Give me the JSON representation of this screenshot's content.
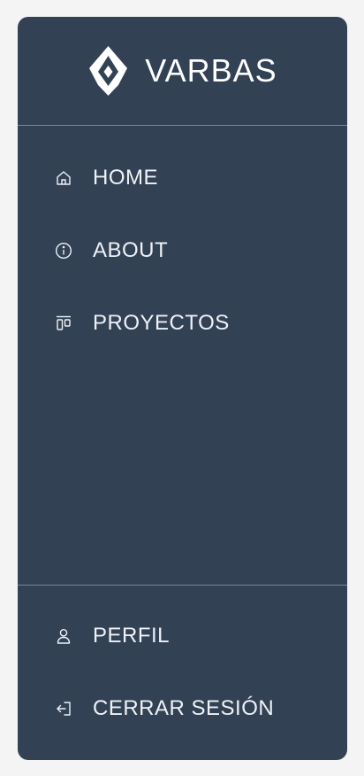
{
  "brand": {
    "name": "VARBAS",
    "logo_icon": "varbas-logo-icon"
  },
  "colors": {
    "page_background": "#f4f4f5",
    "sidebar_background": "#334155",
    "text": "#eef2f6",
    "divider": "#7a8798"
  },
  "nav": {
    "top_items": [
      {
        "label": "HOME",
        "icon": "home-icon"
      },
      {
        "label": "ABOUT",
        "icon": "info-icon"
      },
      {
        "label": "PROYECTOS",
        "icon": "projects-icon"
      }
    ],
    "bottom_items": [
      {
        "label": "PERFIL",
        "icon": "user-icon"
      },
      {
        "label": "CERRAR SESIÓN",
        "icon": "logout-icon"
      }
    ]
  }
}
